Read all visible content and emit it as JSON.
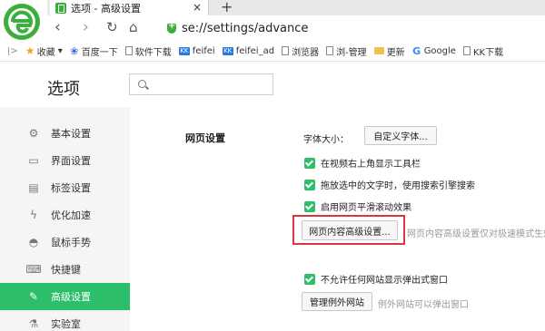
{
  "browser": {
    "tab_title": "选项 - 高级设置",
    "tab_close": "×",
    "new_tab": "+",
    "url": "se://settings/advance"
  },
  "nav_buttons": {
    "back": "‹",
    "forward": "›",
    "reload": "↻",
    "home": "⌂"
  },
  "bookmarks": {
    "toggle": "|>",
    "items": [
      {
        "icon": "star-icon",
        "label": "收藏",
        "suffix": "▾"
      },
      {
        "icon": "paw-icon",
        "label": "百度一下"
      },
      {
        "icon": "page-icon",
        "label": "软件下载"
      },
      {
        "icon": "kk-icon",
        "label": "feifei"
      },
      {
        "icon": "kk-icon",
        "label": "feifei_ad"
      },
      {
        "icon": "page-icon",
        "label": "浏览器"
      },
      {
        "icon": "page-icon",
        "label": "浏-管理"
      },
      {
        "icon": "folder-icon",
        "label": "更新"
      },
      {
        "icon": "google-icon",
        "label": "Google"
      },
      {
        "icon": "page-icon",
        "label": "KK下载"
      }
    ]
  },
  "settings": {
    "title": "选项",
    "search_placeholder": ""
  },
  "sidebar": {
    "items": [
      {
        "icon": "gear-icon",
        "glyph": "⚙",
        "label": "基本设置"
      },
      {
        "icon": "window-icon",
        "glyph": "▭",
        "label": "界面设置"
      },
      {
        "icon": "tabs-icon",
        "glyph": "▤",
        "label": "标签设置"
      },
      {
        "icon": "bolt-icon",
        "glyph": "ϟ",
        "label": "优化加速"
      },
      {
        "icon": "mouse-icon",
        "glyph": "◓",
        "label": "鼠标手势"
      },
      {
        "icon": "keyboard-icon",
        "glyph": "⌨",
        "label": "快捷键"
      },
      {
        "icon": "wrench-icon",
        "glyph": "✎",
        "label": "高级设置"
      },
      {
        "icon": "flask-icon",
        "glyph": "⚗",
        "label": "实验室"
      }
    ],
    "active_index": 6
  },
  "webpage": {
    "section_title": "网页设置",
    "font_size_label": "字体大小：",
    "custom_font_button": "自定义字体...",
    "checkboxes": [
      {
        "label": "在视频右上角显示工具栏",
        "checked": true
      },
      {
        "label": "拖放选中的文字时，使用搜索引擎搜索",
        "checked": true
      },
      {
        "label": "启用网页平滑滚动效果",
        "checked": true
      }
    ],
    "advanced_button": "网页内容高级设置...",
    "advanced_hint": "网页内容高级设置仅对极速模式生效",
    "popup_checkbox": {
      "label": "不允许任何网站显示弹出式窗口",
      "checked": true
    },
    "manage_exceptions_button": "管理例外网站",
    "exceptions_hint": "例外网站可以弹出窗口"
  },
  "colors": {
    "accent": "#2dbe6c",
    "highlight": "#d9363e",
    "logo": "#3cae3c"
  }
}
